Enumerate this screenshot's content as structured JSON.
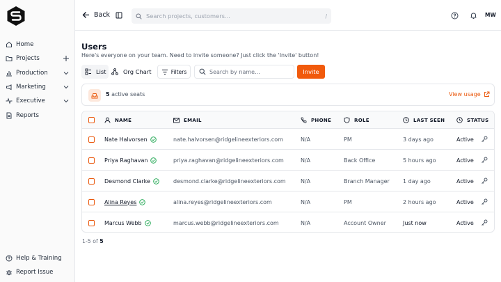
{
  "app": {
    "logo_icon": "hexagon-s-logo",
    "avatar_initials": "MW",
    "accent_color": "#f15a0c"
  },
  "sidebar": {
    "items": [
      {
        "label": "Home",
        "icon": "home-icon"
      },
      {
        "label": "Projects",
        "icon": "folder-icon",
        "trail": "plus"
      },
      {
        "label": "Production",
        "icon": "bar-chart-icon",
        "trail": "chevron"
      },
      {
        "label": "Marketing",
        "icon": "megaphone-icon",
        "trail": "chevron"
      },
      {
        "label": "Executive",
        "icon": "pulse-icon",
        "trail": "chevron"
      },
      {
        "label": "Reports",
        "icon": "document-icon"
      }
    ],
    "bottom_items": [
      {
        "label": "Help & Training",
        "icon": "question-icon"
      },
      {
        "label": "Report Issue",
        "icon": "bug-icon"
      }
    ]
  },
  "topbar": {
    "back_label": "Back",
    "search_placeholder": "Search projects, customers...",
    "search_shortcut": "/"
  },
  "page": {
    "title": "Users",
    "subtitle": "Here's everyone on your team. Need to invite someone? Just click the 'Invite' button!"
  },
  "toolbar": {
    "list_label": "List",
    "org_chart_label": "Org Chart",
    "filters_label": "Filters",
    "name_search_placeholder": "Search by name...",
    "invite_label": "Invite"
  },
  "seats": {
    "count": "5",
    "label": "active seats",
    "view_usage_label": "View usage"
  },
  "table": {
    "headers": {
      "name": "NAME",
      "email": "EMAIL",
      "phone": "PHONE",
      "role": "ROLE",
      "last_seen": "LAST SEEN",
      "status": "STATUS"
    },
    "rows": [
      {
        "name": "Nate Halvorsen",
        "email": "nate.halvorsen@ridgelineexteriors.com",
        "phone": "N/A",
        "role": "PM",
        "last_seen": "3 days ago",
        "status": "Active"
      },
      {
        "name": "Priya Raghavan",
        "email": "priya.raghavan@ridgelineexteriors.com",
        "phone": "N/A",
        "role": "Back Office",
        "last_seen": "5 hours ago",
        "status": "Active"
      },
      {
        "name": "Desmond Clarke",
        "email": "desmond.clarke@ridgelineexteriors.com",
        "phone": "N/A",
        "role": "Branch Manager",
        "last_seen": "1 day ago",
        "status": "Active"
      },
      {
        "name": "Alina Reyes",
        "email": "alina.reyes@ridgelineexteriors.com",
        "phone": "N/A",
        "role": "PM",
        "last_seen": "2 hours ago",
        "status": "Active"
      },
      {
        "name": "Marcus Webb",
        "email": "marcus.webb@ridgelineexteriors.com",
        "phone": "N/A",
        "role": "Account Owner",
        "last_seen": "Just now",
        "status": "Active"
      }
    ]
  },
  "pagination": {
    "range": "1-5",
    "of_label": "of",
    "total": "5"
  }
}
